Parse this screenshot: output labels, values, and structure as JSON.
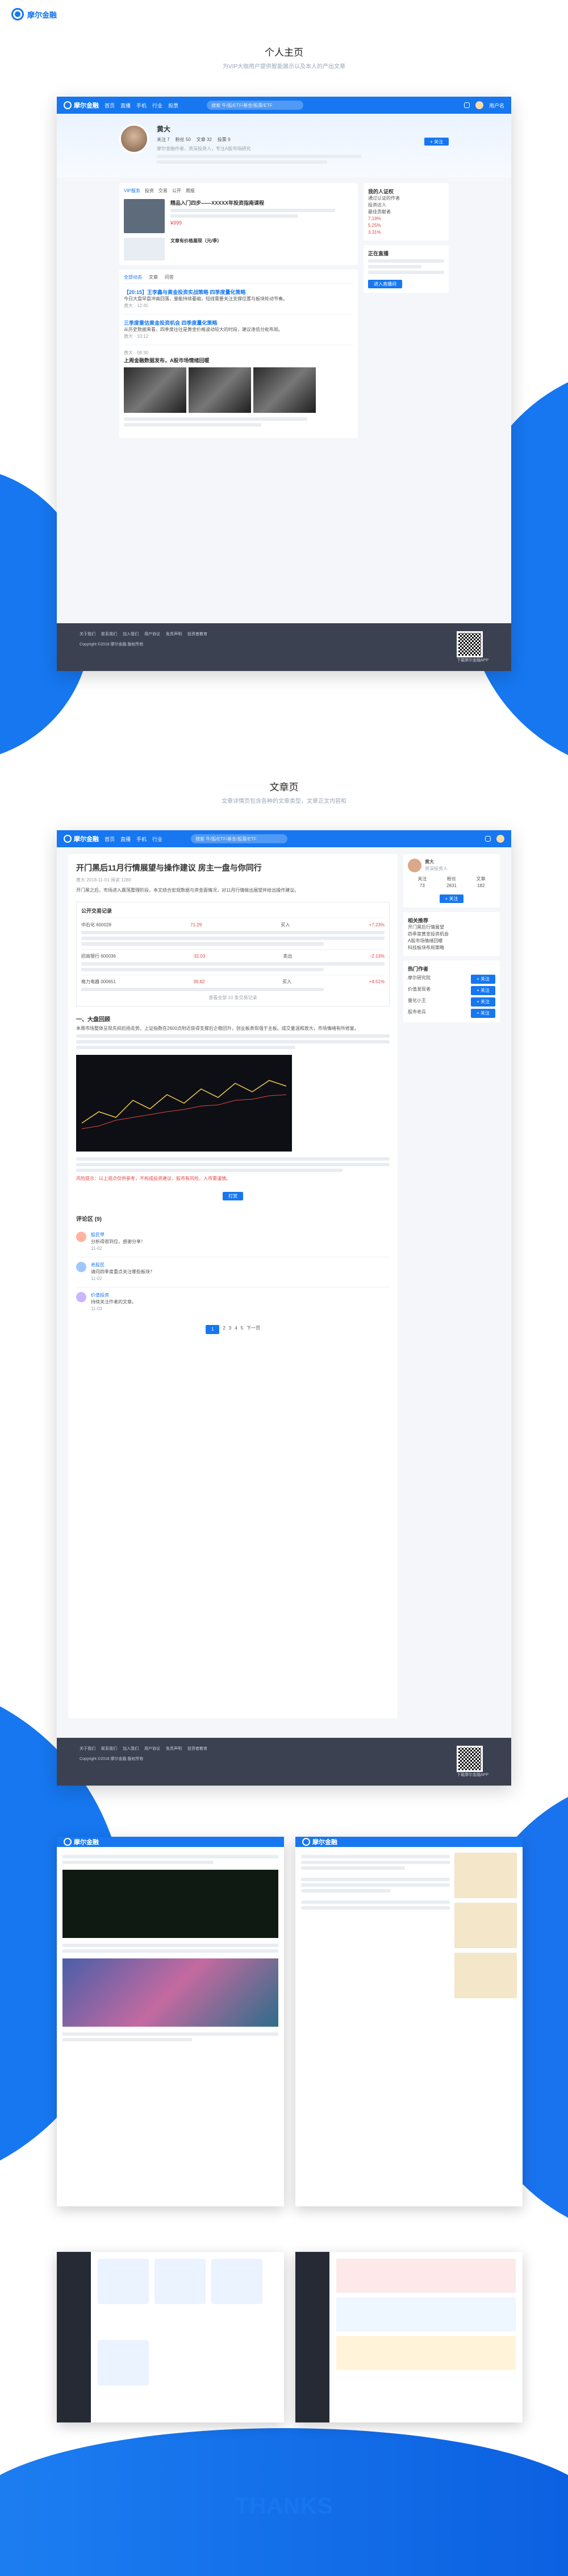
{
  "brand": {
    "name": "摩尔金融",
    "logo_icon": "moore-ring-icon"
  },
  "sections": {
    "profile": {
      "title": "个人主页",
      "subtitle": "为VIP大咖用户提供智能展示以及本人的产出文章"
    },
    "article": {
      "title": "文章页",
      "subtitle": "文章详情页包含各种的文章类型，文章正文内容和"
    }
  },
  "app": {
    "logo": "摩尔金融",
    "nav": [
      "首页",
      "直播",
      "手机",
      "行业",
      "投票"
    ],
    "search_placeholder": "搜索 牛/股/ETF/基金/股票/ETF",
    "login": "用户名"
  },
  "profile": {
    "name": "黄大",
    "stats": [
      "关注 7",
      "粉丝 50",
      "文章 32",
      "投票 9"
    ],
    "bio": "摩尔金融作者，资深投资人，专注A股市场研究",
    "action": "+ 关注",
    "vip_tags": [
      "VIP服务",
      "投资",
      "交易",
      "公开",
      "周报"
    ],
    "featured_title": "精品入门四步——XXXXX年投资指南课程",
    "featured_price": "¥999",
    "feature_card_title": "文章有价格展现（元/季）",
    "filter_tabs": [
      "全部动态",
      "文章",
      "问答"
    ],
    "posts": [
      {
        "title": "【20:15】王李鑫与黄金投资实战策略 四季度量化策略",
        "body": "今日大盘早盘冲高回落，量能持续萎缩，短线需要关注支撑位置与板块轮动节奏。",
        "author": "黄大",
        "time": "12:45"
      },
      {
        "title": "三季度重估黄金投资机会 四季度量化策略",
        "body": "从历史数据来看，四季度往往是黄金价格波动较大的时段，建议逢低分批布局。",
        "author": "黄大",
        "time": "10:12"
      },
      {
        "title": "上周金融数据发布，A股市场情绪回暖",
        "body": "北向资金连续净流入，成长风格持续占优，重点关注科技与消费板块。",
        "author": "黄大",
        "time": "08:30"
      }
    ],
    "sidebar_title": "我的人证权",
    "sidebar_items": [
      "通过认证的作者",
      "投资达人",
      "最佳贡献者"
    ],
    "sidebar_rates": [
      "7.19%",
      "5.25%",
      "3.31%"
    ],
    "live_title": "正在直播",
    "live_button": "进入直播间"
  },
  "footer": {
    "links": [
      "关于我们",
      "联系我们",
      "加入我们",
      "用户协议",
      "免责声明",
      "投资者教育"
    ],
    "copyright": "Copyright ©2018 摩尔金融 版权所有",
    "qr_label": "下载摩尔金融APP"
  },
  "article": {
    "title": "开门黑后11月行情展望与操作建议 房主一盘与你同行",
    "meta": "黄大  2018-11-01  阅读 1280",
    "intro": "开门黑之后，市场进入震荡整理阶段，本文结合宏观数据与资金面情况，对11月行情做出展望并给出操作建议。",
    "trade_header": "公开交易记录",
    "trades": [
      {
        "code": "中石化 600028",
        "price": "71.29",
        "action": "买入",
        "pct": "+7.23%"
      },
      {
        "code": "招商银行 600036",
        "price": "32.03",
        "action": "卖出",
        "pct": "-2.13%"
      },
      {
        "code": "格力电器 000651",
        "price": "39.82",
        "action": "买入",
        "pct": "+4.51%"
      }
    ],
    "more_trades": "查看全部 10 条交易记录",
    "section_head": "一、大盘回顾",
    "paragraph": "本周市场整体呈现先抑后扬走势，上证指数在2600点附近获得支撑后企稳回升，创业板表现强于主板。成交量温和放大，市场情绪有所修复。",
    "highlight": "风险提示：以上观点仅供参考，不构成投资建议，股市有风险，入市需谨慎。",
    "buy_button": "打赏",
    "comments_title": "评论区 (9)",
    "comments": [
      {
        "user": "股民甲",
        "text": "分析得很到位，感谢分享！",
        "time": "11-02"
      },
      {
        "user": "老股民",
        "text": "请问四季度重点关注哪些板块？",
        "time": "11-02"
      },
      {
        "user": "价值投资",
        "text": "持续关注作者的文章。",
        "time": "11-03"
      }
    ],
    "pagination": [
      "1",
      "2",
      "3",
      "4",
      "5",
      "下一页"
    ],
    "author_card": {
      "name": "黄大",
      "desc": "资深投资人",
      "stats": [
        "关注",
        "粉丝",
        "文章"
      ],
      "values": [
        "73",
        "2831",
        "182"
      ]
    },
    "related_title": "相关推荐",
    "related": [
      "开门黑后行情展望",
      "四季度黄金投资机会",
      "A股市场情绪回暖",
      "科技板块布局策略"
    ],
    "popular_title": "热门作者",
    "popular": [
      "摩尔研究院",
      "价值发现者",
      "量化小王",
      "股市老兵"
    ],
    "follow_btn": "+ 关注"
  },
  "thanks": "THANKS"
}
